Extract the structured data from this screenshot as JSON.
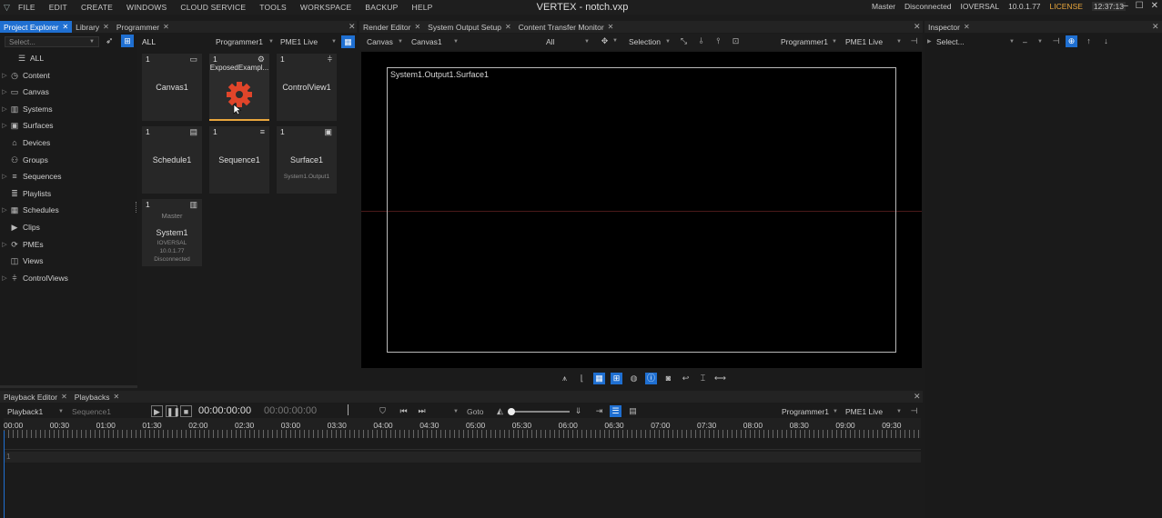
{
  "menu": [
    "FILE",
    "EDIT",
    "CREATE",
    "WINDOWS",
    "CLOUD SERVICE",
    "TOOLS",
    "WORKSPACE",
    "BACKUP",
    "HELP"
  ],
  "title": "VERTEX - notch.vxp",
  "status": {
    "role": "Master",
    "connection": "Disconnected",
    "user": "IOVERSAL",
    "version": "10.0.1.77",
    "license": "LICENSE",
    "time": "12:37:13"
  },
  "left_tabs": [
    {
      "label": "Project Explorer"
    },
    {
      "label": "Library"
    },
    {
      "label": "Programmer"
    }
  ],
  "select_placeholder": "Select...",
  "tree": [
    {
      "label": "ALL",
      "icon": "stack-icon",
      "expandable": false
    },
    {
      "label": "Content",
      "icon": "content-icon",
      "expandable": true
    },
    {
      "label": "Canvas",
      "icon": "canvas-icon",
      "expandable": true
    },
    {
      "label": "Systems",
      "icon": "server-icon",
      "expandable": true
    },
    {
      "label": "Surfaces",
      "icon": "surface-icon",
      "expandable": true
    },
    {
      "label": "Devices",
      "icon": "devices-icon",
      "expandable": false
    },
    {
      "label": "Groups",
      "icon": "groups-icon",
      "expandable": false
    },
    {
      "label": "Sequences",
      "icon": "sequence-icon",
      "expandable": true
    },
    {
      "label": "Playlists",
      "icon": "playlist-icon",
      "expandable": false
    },
    {
      "label": "Schedules",
      "icon": "calendar-icon",
      "expandable": true
    },
    {
      "label": "Clips",
      "icon": "clip-icon",
      "expandable": false
    },
    {
      "label": "PMEs",
      "icon": "pme-icon",
      "expandable": true
    },
    {
      "label": "Views",
      "icon": "view-icon",
      "expandable": false
    },
    {
      "label": "ControlViews",
      "icon": "controlview-icon",
      "expandable": true
    }
  ],
  "explorer": {
    "filter_label": "ALL",
    "programmer": "Programmer1",
    "pme": "PME1 Live",
    "tiles": [
      {
        "num": "1",
        "name": "Canvas1",
        "sub": "",
        "top": ""
      },
      {
        "num": "1",
        "name": "ExposedExampl...",
        "sub": "",
        "top": ""
      },
      {
        "num": "1",
        "name": "ControlView1",
        "sub": "",
        "top": ""
      },
      {
        "num": "1",
        "name": "Schedule1",
        "sub": "",
        "top": ""
      },
      {
        "num": "1",
        "name": "Sequence1",
        "sub": "",
        "top": ""
      },
      {
        "num": "1",
        "name": "Surface1",
        "sub": "System1.Output1",
        "top": ""
      },
      {
        "num": "1",
        "name": "System1",
        "sub": "IOVERSAL\n10.0.1.77\nDisconnected",
        "top": "Master"
      }
    ]
  },
  "center_tabs": [
    {
      "label": "Render Editor"
    },
    {
      "label": "System Output Setup"
    },
    {
      "label": "Content Transfer Monitor"
    }
  ],
  "render": {
    "mode": "Canvas",
    "canvas": "Canvas1",
    "filter": "All",
    "tool": "Selection",
    "programmer": "Programmer1",
    "pme": "PME1 Live",
    "surface_label": "System1.Output1.Surface1"
  },
  "inspector": {
    "tab": "Inspector",
    "select": "Select...",
    "minus": "–"
  },
  "bottom_tabs": [
    {
      "label": "Playback Editor"
    },
    {
      "label": "Playbacks"
    }
  ],
  "playback": {
    "name": "Playback1",
    "sequence": "Sequence1",
    "time": "00:00:00:00",
    "time2": "00:00:00:00",
    "goto": "Goto",
    "programmer": "Programmer1",
    "pme": "PME1 Live",
    "track": "1",
    "ruler": [
      "00:00",
      "00:30",
      "01:00",
      "01:30",
      "02:00",
      "02:30",
      "03:00",
      "03:30",
      "04:00",
      "04:30",
      "05:00",
      "05:30",
      "06:00",
      "06:30",
      "07:00",
      "07:30",
      "08:00",
      "08:30",
      "09:00",
      "09:30"
    ]
  },
  "colors": {
    "accent": "#1f6fd1",
    "license": "#e8a63c",
    "gear": "#e0452a"
  }
}
